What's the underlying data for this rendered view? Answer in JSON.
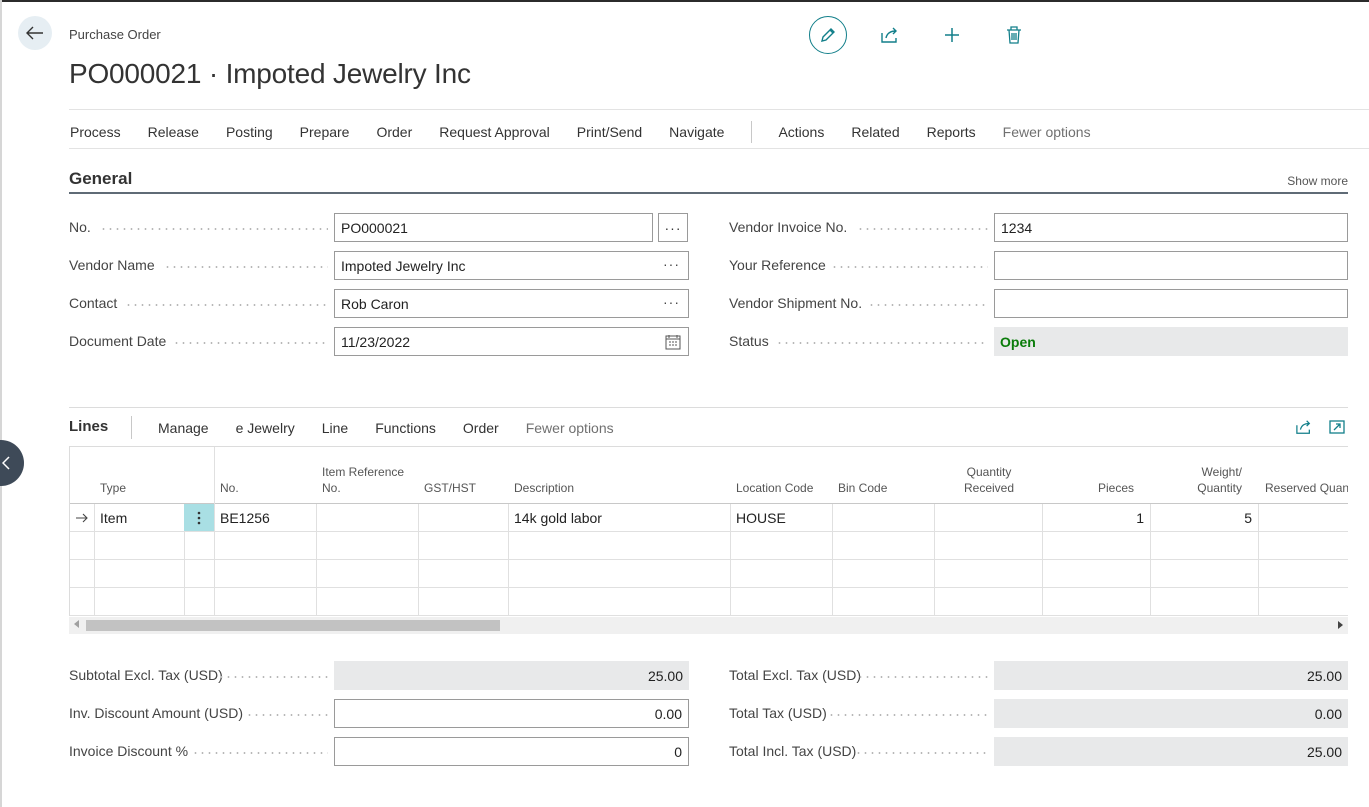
{
  "breadcrumb": "Purchase Order",
  "title": "PO000021 · Impoted Jewelry Inc",
  "top_actions": [
    {
      "icon": "pencil-icon"
    },
    {
      "icon": "share-icon"
    },
    {
      "icon": "plus-icon"
    },
    {
      "icon": "trash-icon"
    }
  ],
  "menu": {
    "items": [
      "Process",
      "Release",
      "Posting",
      "Prepare",
      "Order",
      "Request Approval",
      "Print/Send",
      "Navigate"
    ],
    "secondary": [
      "Actions",
      "Related",
      "Reports"
    ],
    "fewer_options": "Fewer options"
  },
  "general": {
    "title": "General",
    "show_more": "Show more",
    "left": [
      {
        "label": "No.",
        "value": "PO000021"
      },
      {
        "label": "Vendor Name",
        "value": "Impoted Jewelry Inc"
      },
      {
        "label": "Contact",
        "value": "Rob Caron"
      },
      {
        "label": "Document Date",
        "value": "11/23/2022"
      }
    ],
    "right": [
      {
        "label": "Vendor Invoice No.",
        "value": "1234"
      },
      {
        "label": "Your Reference",
        "value": ""
      },
      {
        "label": "Vendor Shipment No.",
        "value": ""
      },
      {
        "label": "Status",
        "value": "Open"
      }
    ],
    "ellipsis": "···"
  },
  "lines": {
    "title": "Lines",
    "menu": [
      "Manage",
      "e Jewelry",
      "Line",
      "Functions",
      "Order"
    ],
    "fewer_options": "Fewer options",
    "columns": {
      "type": "Type",
      "no": "No.",
      "item_ref_1": "Item Reference",
      "item_ref_2": "No.",
      "gst": "GST/HST",
      "description": "Description",
      "location": "Location Code",
      "bin": "Bin Code",
      "qty_rec_1": "Quantity",
      "qty_rec_2": "Received",
      "pieces": "Pieces",
      "weight_1": "Weight/",
      "weight_2": "Quantity",
      "reserved": "Reserved Quant"
    },
    "rows": [
      {
        "type": "Item",
        "no": "BE1256",
        "item_ref": "",
        "gst": "",
        "description": "14k gold labor",
        "location": "HOUSE",
        "bin": "",
        "qty_received": "",
        "pieces": "1",
        "weight": "5"
      }
    ]
  },
  "totals": {
    "left": [
      {
        "label": "Subtotal Excl. Tax (USD)",
        "value": "25.00"
      },
      {
        "label": "Inv. Discount Amount (USD)",
        "value": "0.00"
      },
      {
        "label": "Invoice Discount %",
        "value": "0"
      }
    ],
    "right": [
      {
        "label": "Total Excl. Tax (USD)",
        "value": "25.00"
      },
      {
        "label": "Total Tax (USD)",
        "value": "0.00"
      },
      {
        "label": "Total Incl. Tax (USD)",
        "value": "25.00"
      }
    ]
  },
  "colors": {
    "accent": "#127f8a",
    "status_open": "#0a7c0a",
    "selected_cell": "#a9dfe4"
  }
}
